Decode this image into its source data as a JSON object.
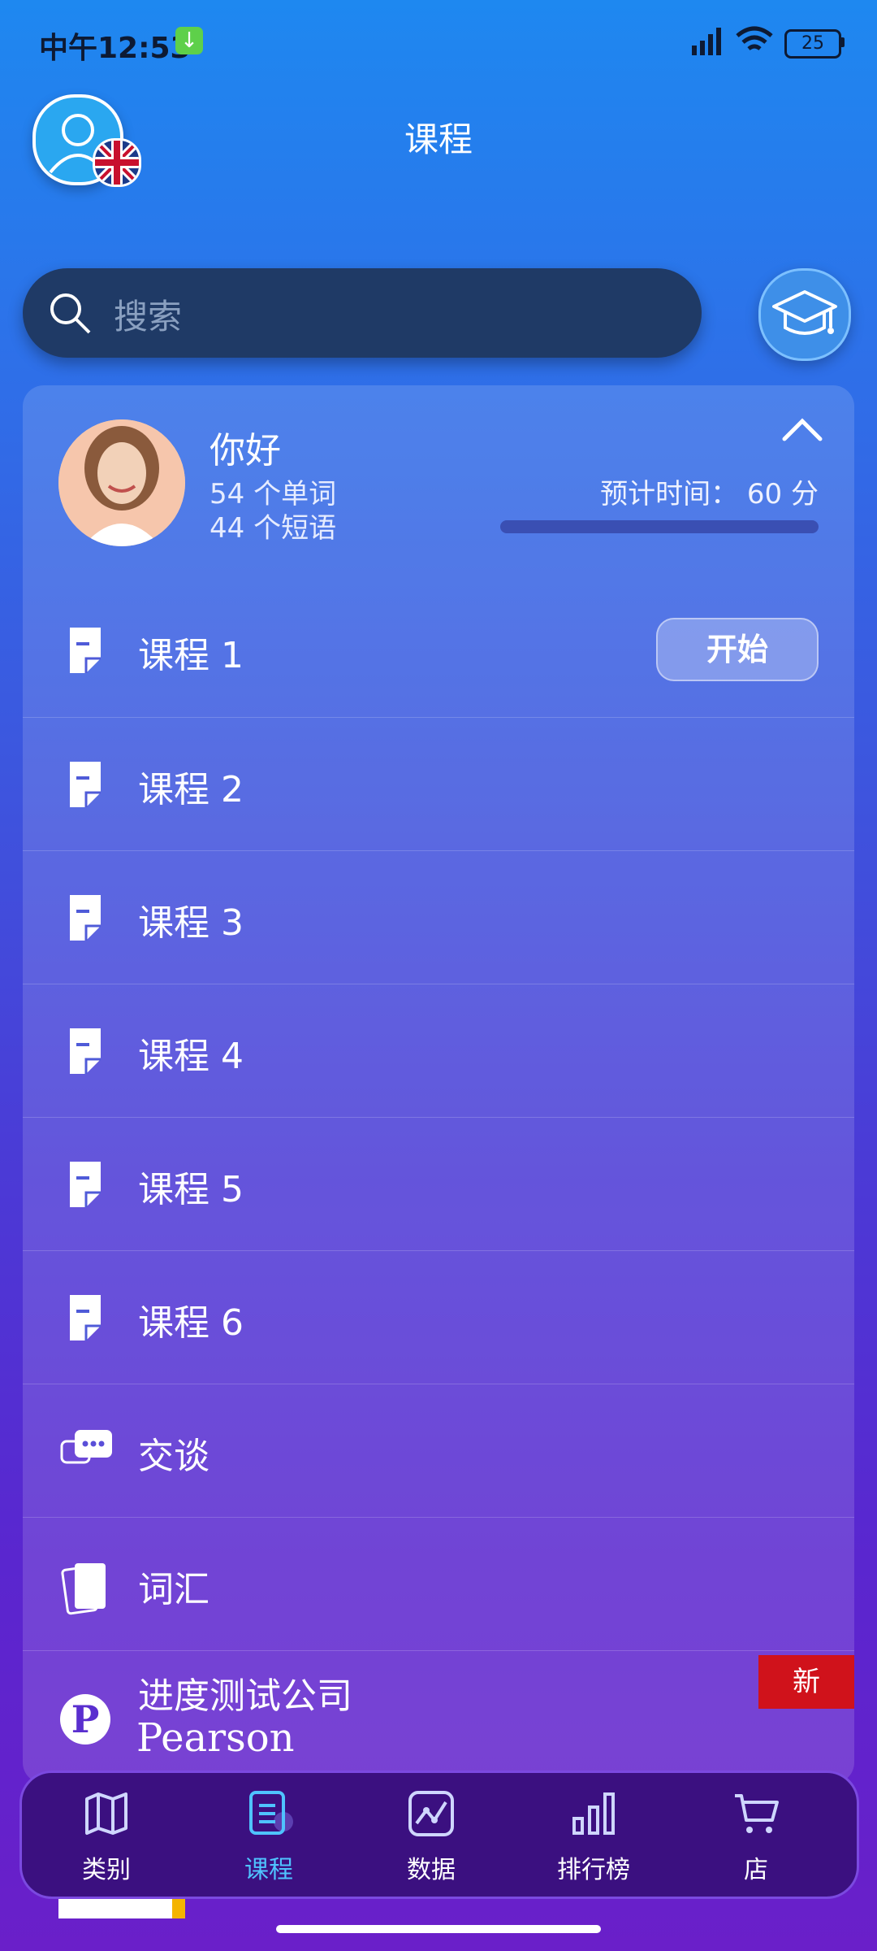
{
  "status_bar": {
    "time": "中午12:53",
    "battery": "25"
  },
  "header": {
    "title": "课程"
  },
  "search": {
    "placeholder": "搜索"
  },
  "tutor_card": {
    "greeting": "你好",
    "words": "54 个单词",
    "phrases": "44 个短语",
    "estimated_time": "预计时间： 60 分",
    "progress": 0
  },
  "lessons": [
    {
      "label": "课程 1",
      "action": "开始"
    },
    {
      "label": "课程 2"
    },
    {
      "label": "课程 3"
    },
    {
      "label": "课程 4"
    },
    {
      "label": "课程 5"
    },
    {
      "label": "课程 6"
    }
  ],
  "extras": {
    "talk": "交谈",
    "vocab": "词汇",
    "pearson_title": "进度测试公司",
    "pearson_logo": "Pearson",
    "new_badge": "新"
  },
  "nav": [
    {
      "label": "类别",
      "icon": "map-icon"
    },
    {
      "label": "课程",
      "icon": "list-icon",
      "active": true
    },
    {
      "label": "数据",
      "icon": "stats-icon"
    },
    {
      "label": "排行榜",
      "icon": "leaderboard-icon"
    },
    {
      "label": "店",
      "icon": "cart-icon"
    }
  ],
  "colors": {
    "accent": "#4fc3ff",
    "badge": "#d0121b",
    "search_bg": "#1f3a66"
  }
}
